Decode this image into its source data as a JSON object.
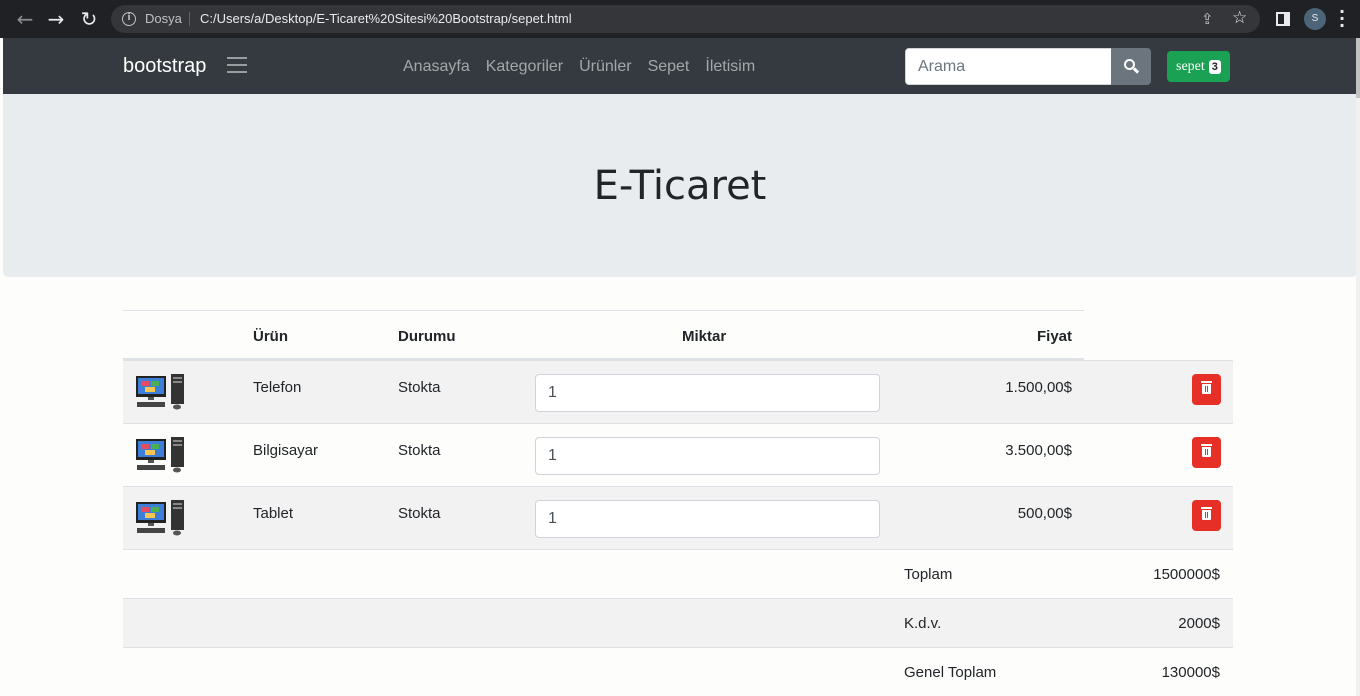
{
  "browser": {
    "security_label": "Dosya",
    "url": "C:/Users/a/Desktop/E-Ticaret%20Sitesi%20Bootstrap/sepet.html",
    "profile_initial": "S"
  },
  "navbar": {
    "brand": "bootstrap",
    "links": [
      "Anasayfa",
      "Kategoriler",
      "Ürünler",
      "Sepet",
      "İletisim"
    ],
    "search_placeholder": "Arama",
    "cart_label": "sepet",
    "cart_count": "3",
    "cart_color": "#1aa153"
  },
  "jumbotron": {
    "title": "E-Ticaret"
  },
  "table": {
    "headers": {
      "product": "Ürün",
      "status": "Durumu",
      "quantity": "Miktar",
      "price": "Fiyat"
    },
    "rows": [
      {
        "name": "Telefon",
        "status": "Stokta",
        "quantity": "1",
        "price": "1.500,00$"
      },
      {
        "name": "Bilgisayar",
        "status": "Stokta",
        "quantity": "1",
        "price": "3.500,00$"
      },
      {
        "name": "Tablet",
        "status": "Stokta",
        "quantity": "1",
        "price": "500,00$"
      }
    ],
    "summary": [
      {
        "label": "Toplam",
        "value": "1500000$"
      },
      {
        "label": "K.d.v.",
        "value": "2000$"
      },
      {
        "label": "Genel Toplam",
        "value": "130000$"
      }
    ],
    "delete_color": "#e62f26"
  }
}
